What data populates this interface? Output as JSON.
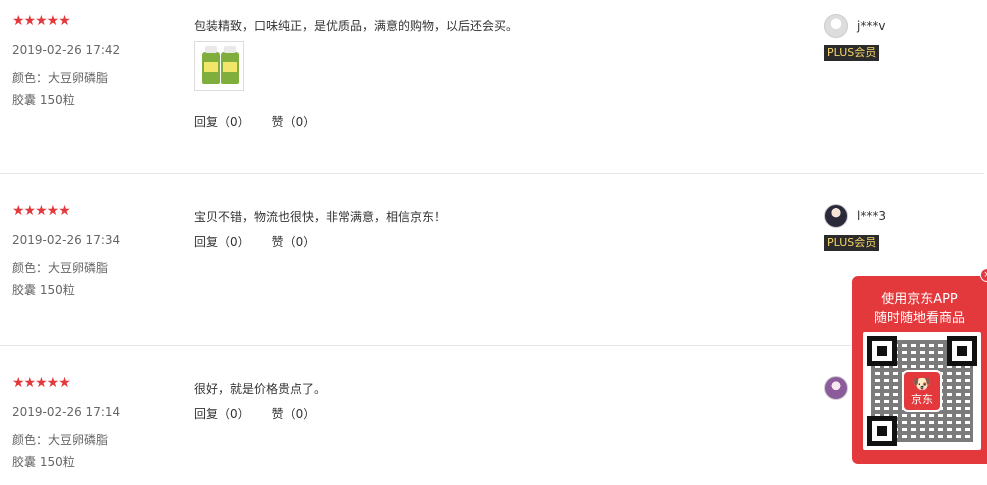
{
  "reviews": [
    {
      "stars": "★★★★★",
      "date": "2019-02-26 17:42",
      "attr_color": "颜色：大豆卵磷脂",
      "attr_size": "胶囊 150粒",
      "content": "包装精致，口味纯正，是优质品，满意的购物，以后还会买。",
      "reply": "回复（0）",
      "like": "赞（0）",
      "user": "j***v",
      "badge": "PLUS会员"
    },
    {
      "stars": "★★★★★",
      "date": "2019-02-26 17:34",
      "attr_color": "颜色：大豆卵磷脂",
      "attr_size": "胶囊 150粒",
      "content": "宝贝不错，物流也很快，非常满意，相信京东！",
      "reply": "回复（0）",
      "like": "赞（0）",
      "user": "l***3",
      "badge": "PLUS会员"
    },
    {
      "stars": "★★★★★",
      "date": "2019-02-26 17:14",
      "attr_color": "颜色：大豆卵磷脂",
      "attr_size": "胶囊 150粒",
      "content": "很好，就是价格贵点了。",
      "reply": "回复（0）",
      "like": "赞（0）"
    }
  ],
  "app_promo": {
    "line1": "使用京东APP",
    "line2": "随时随地看商品",
    "logo_text": "京东",
    "close": "×"
  },
  "colors": {
    "accent": "#e4393c",
    "plus_bg": "#2b2b2b",
    "plus_text": "#f5d36a"
  }
}
